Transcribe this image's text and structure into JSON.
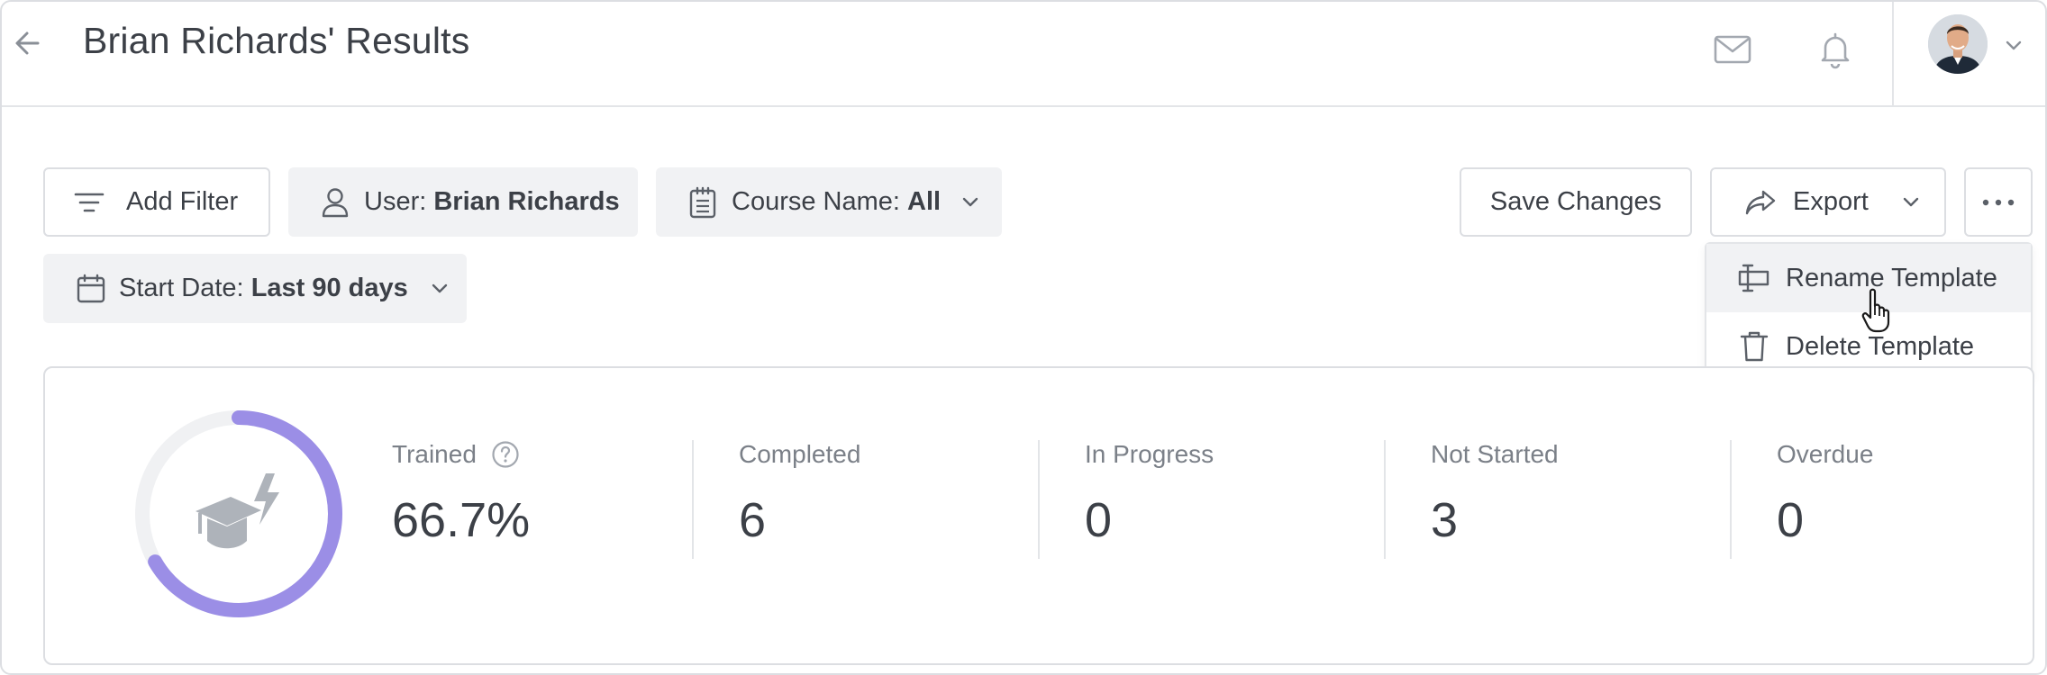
{
  "header": {
    "title": "Brian Richards' Results",
    "icons": [
      "back-arrow-icon",
      "mail-icon",
      "bell-icon",
      "chevron-down-icon"
    ]
  },
  "filters": {
    "add_filter": "Add Filter",
    "user_label": "User:",
    "user_value": "Brian Richards",
    "course_label": "Course Name:",
    "course_value": "All",
    "date_label": "Start Date:",
    "date_value": "Last 90 days"
  },
  "actions": {
    "save_changes": "Save Changes",
    "export": "Export"
  },
  "menu": {
    "items": [
      {
        "label": "Rename Template",
        "icon": "rename-icon",
        "hovered": true
      },
      {
        "label": "Delete Template",
        "icon": "trash-icon",
        "hovered": false
      }
    ]
  },
  "stats": {
    "trained_label": "Trained",
    "trained_value": "66.7%",
    "trained_fraction": 0.667,
    "items": [
      {
        "label": "Completed",
        "value": "6"
      },
      {
        "label": "In Progress",
        "value": "0"
      },
      {
        "label": "Not Started",
        "value": "3"
      },
      {
        "label": "Overdue",
        "value": "0"
      }
    ]
  },
  "colors": {
    "accent": "#9b8ee6",
    "ring_track": "#f0f1f3",
    "icon_gray": "#a3a8b0",
    "text": "#3c4047",
    "muted": "#7b8088"
  }
}
